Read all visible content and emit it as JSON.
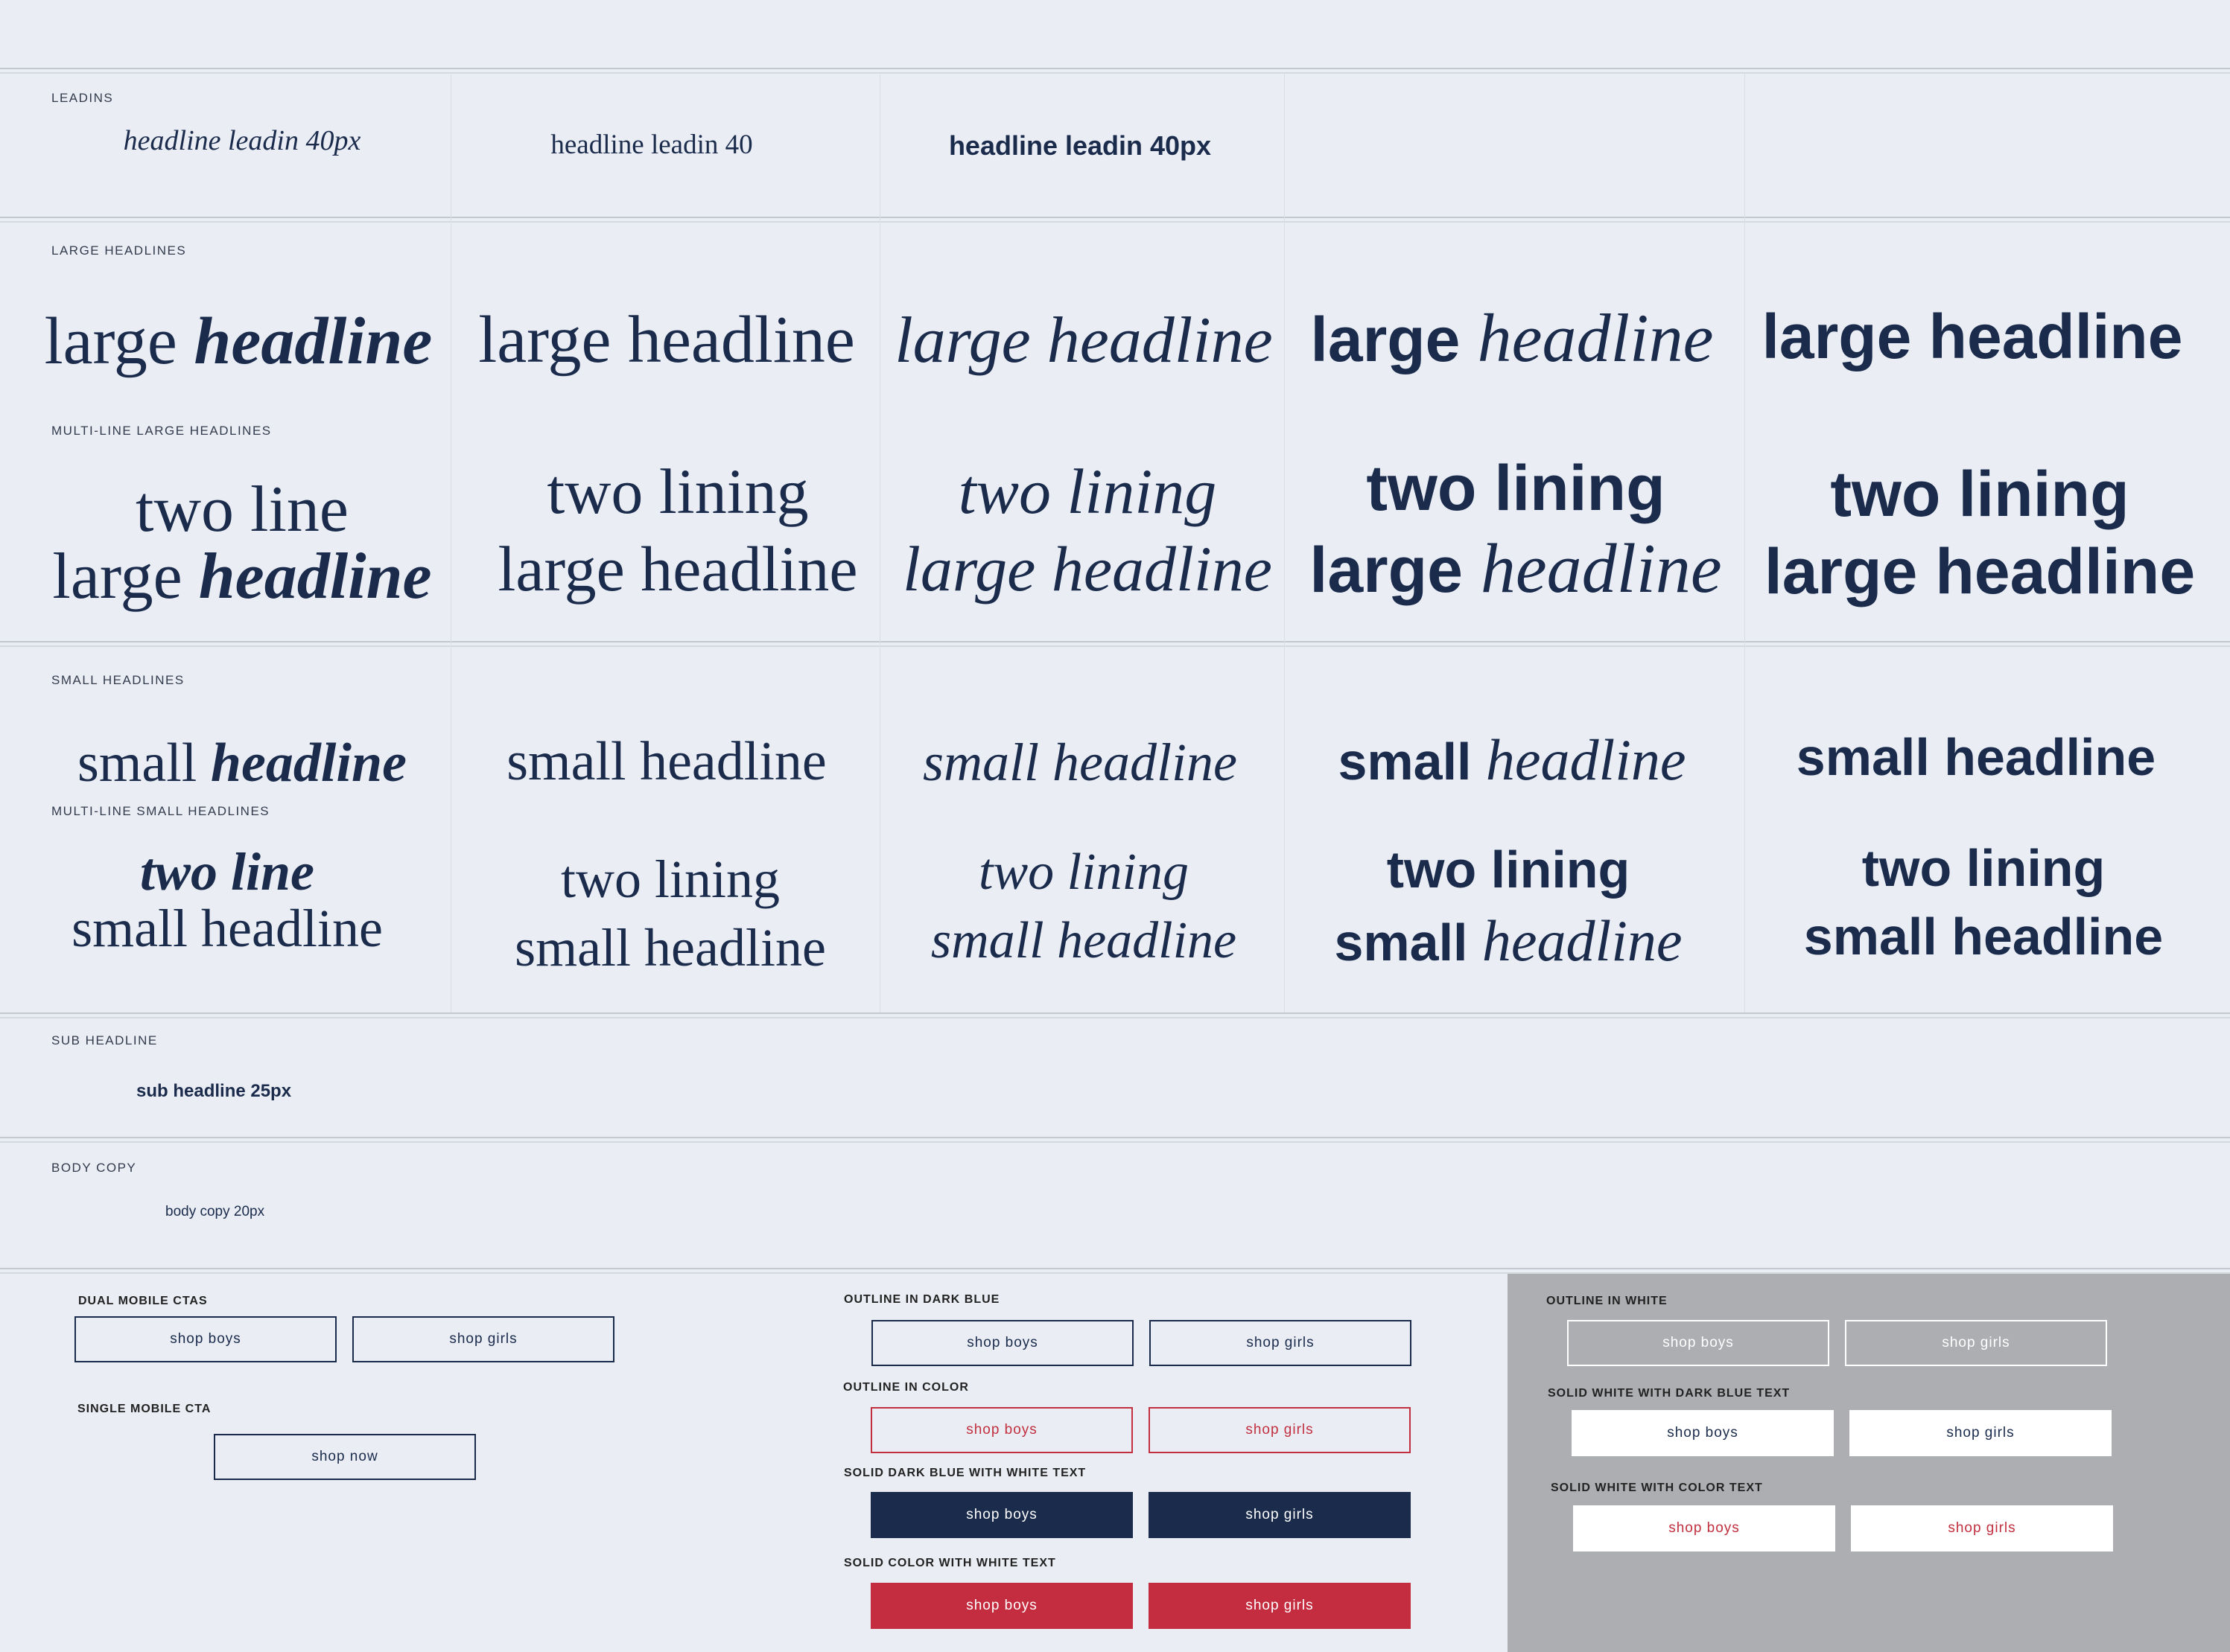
{
  "labels": {
    "leadins": "LEADINS",
    "large_headlines": "LARGE HEADLINES",
    "multi_large": "MULTI-LINE LARGE HEADLINES",
    "small_headlines": "SMALL HEADLINES",
    "multi_small": "MULTI-LINE SMALL HEADLINES",
    "sub_headline": "SUB HEADLINE",
    "body_copy": "BODY COPY"
  },
  "leadins": {
    "italic": "headline leadin 40px",
    "serif": "headline leadin 40",
    "sans": "headline leadin 40px"
  },
  "large": {
    "word_large": "large",
    "word_headline": "headline",
    "full": "large headline"
  },
  "multi_large": {
    "two_line": "two line",
    "two_lining": "two lining",
    "large_headline": "large headline",
    "large": "large",
    "headline": "headline"
  },
  "small": {
    "word_small": "small",
    "word_headline": "headline",
    "full": "small headline"
  },
  "multi_small": {
    "two_line": "two line",
    "two_lining": "two lining",
    "small_headline": "small headline",
    "small": "small",
    "headline": "headline"
  },
  "sub_headline_text": "sub headline 25px",
  "body_copy_text": "body copy 20px",
  "ctas": {
    "dual_mobile": "DUAL MOBILE CTAS",
    "single_mobile": "SINGLE MOBILE CTA",
    "outline_dark_blue": "OUTLINE IN DARK BLUE",
    "outline_color": "OUTLINE IN COLOR",
    "solid_dark_blue": "SOLID DARK BLUE WITH WHITE TEXT",
    "solid_color": "SOLID  COLOR WITH WHITE TEXT",
    "outline_white": "OUTLINE IN WHITE",
    "solid_white_dark": "SOLID WHITE WITH DARK BLUE TEXT",
    "solid_white_color": "SOLID WHITE WITH COLOR TEXT",
    "shop_boys": "shop boys",
    "shop_girls": "shop girls",
    "shop_now": "shop now"
  },
  "colors": {
    "background": "#eaedf4",
    "navy": "#1a2b4c",
    "red": "#c42d40",
    "grey_panel": "#adaeb1",
    "white": "#ffffff"
  }
}
